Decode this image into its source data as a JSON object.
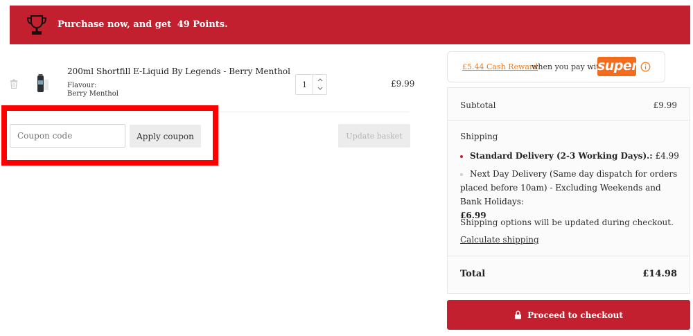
{
  "banner": {
    "text": "Purchase now, and get",
    "points": "49 Points."
  },
  "cart": {
    "item": {
      "name": "200ml Shortfill E-Liquid By Legends - Berry Menthol",
      "flavour_label": "Flavour:",
      "flavour_value": "Berry Menthol",
      "quantity": "1",
      "price": "£9.99"
    },
    "coupon_placeholder": "Coupon code",
    "apply_coupon_label": "Apply coupon",
    "update_basket_label": "Update basket"
  },
  "reward": {
    "amount_link": "£5.44 Cash Reward",
    "text": "when you pay with",
    "brand": "super"
  },
  "totals": {
    "subtotal_label": "Subtotal",
    "subtotal_value": "£9.99",
    "shipping_label": "Shipping",
    "option1_name": "Standard Delivery (2-3 Working Days).:",
    "option1_price": "£4.99",
    "option2_text": "Next Day Delivery (Same day dispatch for orders placed before 10am) - Excluding Weekends and Bank Holidays:",
    "option2_price": "£6.99",
    "shipping_note": "Shipping options will be updated during checkout.",
    "calculate_shipping": "Calculate shipping",
    "total_label": "Total",
    "total_value": "£14.98"
  },
  "checkout": {
    "label": "Proceed to checkout"
  },
  "colors": {
    "brand_red": "#c3202f",
    "super_orange": "#f36b1c",
    "highlight": "#ff0000"
  }
}
